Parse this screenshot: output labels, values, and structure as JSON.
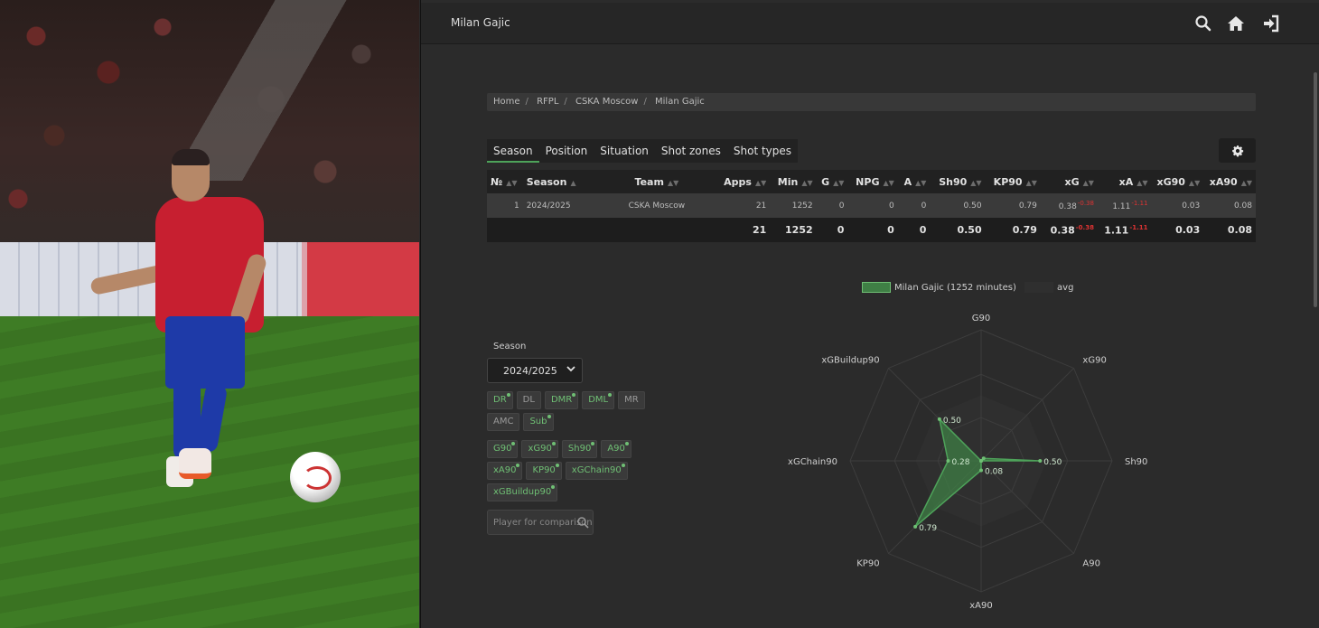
{
  "app": {
    "title": "Milan Gajic"
  },
  "breadcrumb": [
    "Home",
    "RFPL",
    "CSKA Moscow",
    "Milan Gajic"
  ],
  "tabs": [
    "Season",
    "Position",
    "Situation",
    "Shot zones",
    "Shot types"
  ],
  "table": {
    "headers": [
      "№",
      "Season",
      "Team",
      "Apps",
      "Min",
      "G",
      "NPG",
      "A",
      "Sh90",
      "KP90",
      "xG",
      "xA",
      "xG90",
      "xA90"
    ],
    "row": {
      "no": "1",
      "season": "2024/2025",
      "team": "CSKA Moscow",
      "apps": "21",
      "min": "1252",
      "g": "0",
      "npg": "0",
      "a": "0",
      "sh90": "0.50",
      "kp90": "0.79",
      "xg": "0.38",
      "xg_delta": "-0.38",
      "xa": "1.11",
      "xa_delta": "-1.11",
      "xg90": "0.03",
      "xa90": "0.08"
    },
    "total": {
      "apps": "21",
      "min": "1252",
      "g": "0",
      "npg": "0",
      "a": "0",
      "sh90": "0.50",
      "kp90": "0.79",
      "xg": "0.38",
      "xg_delta": "-0.38",
      "xa": "1.11",
      "xa_delta": "-1.11",
      "xg90": "0.03",
      "xa90": "0.08"
    }
  },
  "legend": {
    "player": "Milan Gajic (1252 minutes)",
    "avg": "avg",
    "player_color": "#3f7f45",
    "avg_color": "#2f2f2f"
  },
  "season_filter": {
    "label": "Season",
    "value": "2024/2025"
  },
  "positions": [
    {
      "label": "DR",
      "on": true
    },
    {
      "label": "DL",
      "on": false
    },
    {
      "label": "DMR",
      "on": true
    },
    {
      "label": "DML",
      "on": true
    },
    {
      "label": "MR",
      "on": false
    },
    {
      "label": "AMC",
      "on": false
    },
    {
      "label": "Sub",
      "on": true
    }
  ],
  "metrics": [
    "G90",
    "xG90",
    "Sh90",
    "A90",
    "xA90",
    "KP90",
    "xGChain90",
    "xGBuildup90"
  ],
  "compare": {
    "placeholder": "Player for comparison"
  },
  "chart_data": {
    "type": "radar",
    "axes": [
      "G90",
      "xG90",
      "Sh90",
      "A90",
      "xA90",
      "KP90",
      "xGChain90",
      "xGBuildup90"
    ],
    "series": [
      {
        "name": "Milan Gajic (1252 minutes)",
        "values": [
          0,
          0.03,
          0.5,
          0,
          0.08,
          0.79,
          0.28,
          0.5
        ]
      }
    ],
    "labels": [
      "0.50",
      "0.50",
      "0.28",
      "0.79",
      "0.08"
    ],
    "colors": {
      "player": "#3f7f45",
      "avg": "#2f2f2f",
      "accent": "#4ea35a"
    }
  }
}
